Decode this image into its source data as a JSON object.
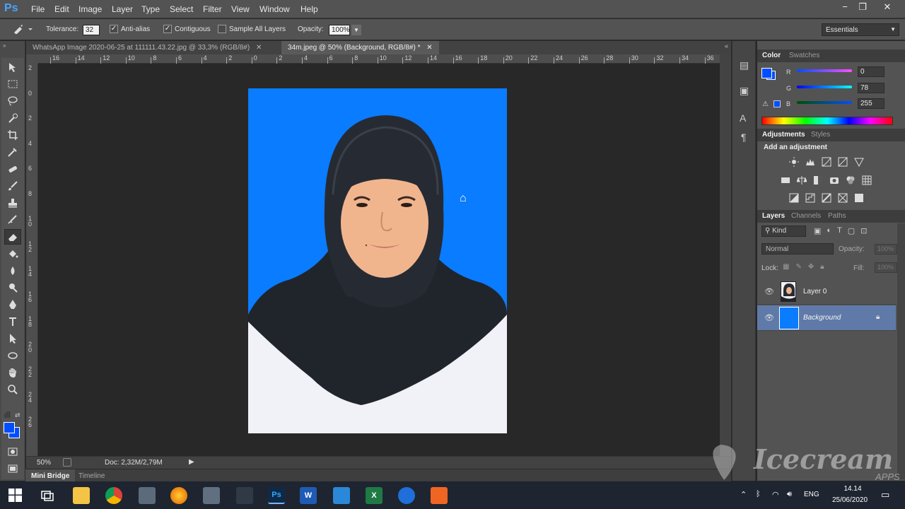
{
  "app": {
    "logo": "Ps"
  },
  "menu": [
    "File",
    "Edit",
    "Image",
    "Layer",
    "Type",
    "Select",
    "Filter",
    "View",
    "Window",
    "Help"
  ],
  "window_controls": [
    "−",
    "❐",
    "✕"
  ],
  "options_bar": {
    "tolerance_label": "Tolerance:",
    "tolerance_value": "32",
    "anti_alias_label": "Anti-alias",
    "anti_alias_checked": true,
    "contiguous_label": "Contiguous",
    "contiguous_checked": true,
    "sample_all_label": "Sample All Layers",
    "sample_all_checked": false,
    "opacity_label": "Opacity:",
    "opacity_value": "100%"
  },
  "workspace": {
    "preset": "Essentials"
  },
  "tabs": [
    {
      "label": "WhatsApp Image 2020-06-25 at 111111.43.22.jpg @ 33,3% (RGB/8#)",
      "close": "✕",
      "active": false
    },
    {
      "label": "34m.jpeg @ 50% (Background, RGB/8#) *",
      "close": "✕",
      "active": true
    }
  ],
  "rulers": {
    "top": [
      "16",
      "14",
      "12",
      "10",
      "8",
      "6",
      "4",
      "2",
      "0",
      "2",
      "4",
      "6",
      "8",
      "10",
      "12",
      "14",
      "16",
      "18",
      "20",
      "22",
      "24",
      "26",
      "28",
      "30",
      "32",
      "34",
      "36"
    ],
    "left": [
      "2",
      "0",
      "2",
      "4",
      "6",
      "8",
      "1\n0",
      "1\n2",
      "1\n4",
      "1\n6",
      "1\n8",
      "2\n0",
      "2\n2",
      "2\n4",
      "2\n6"
    ]
  },
  "status": {
    "zoom": "50%",
    "doc": "Doc: 2,32M/2,79M"
  },
  "bottom_tabs": {
    "mini_bridge": "Mini Bridge",
    "timeline": "Timeline"
  },
  "color_panel": {
    "tabs": [
      "Color",
      "Swatches"
    ],
    "r_label": "R",
    "r_value": "0",
    "g_label": "G",
    "g_value": "78",
    "b_label": "B",
    "b_value": "255",
    "foreground": "#004eff"
  },
  "adjustments_panel": {
    "tabs": [
      "Adjustments",
      "Styles"
    ],
    "heading": "Add an adjustment"
  },
  "layers_panel": {
    "tabs": [
      "Layers",
      "Channels",
      "Paths"
    ],
    "filter": "Kind",
    "blend_mode": "Normal",
    "opacity_label": "Opacity:",
    "opacity_value": "100%",
    "lock_label": "Lock:",
    "fill_label": "Fill:",
    "fill_value": "100%",
    "layers": [
      {
        "name": "Layer 0",
        "selected": false,
        "locked": false
      },
      {
        "name": "Background",
        "selected": true,
        "locked": true
      }
    ]
  },
  "taskbar": {
    "lang": "ENG",
    "time": "14.14",
    "date": "25/06/2020",
    "apps": [
      {
        "name": "Ps",
        "color": "#0e2a47",
        "fg": "#31a8ff"
      },
      {
        "name": "W",
        "color": "#1f5bb5",
        "fg": "#fff"
      },
      {
        "name": "X",
        "color": "#1f7a43",
        "fg": "#fff"
      }
    ]
  },
  "watermark": {
    "text": "Icecream",
    "sub": "APPS"
  }
}
